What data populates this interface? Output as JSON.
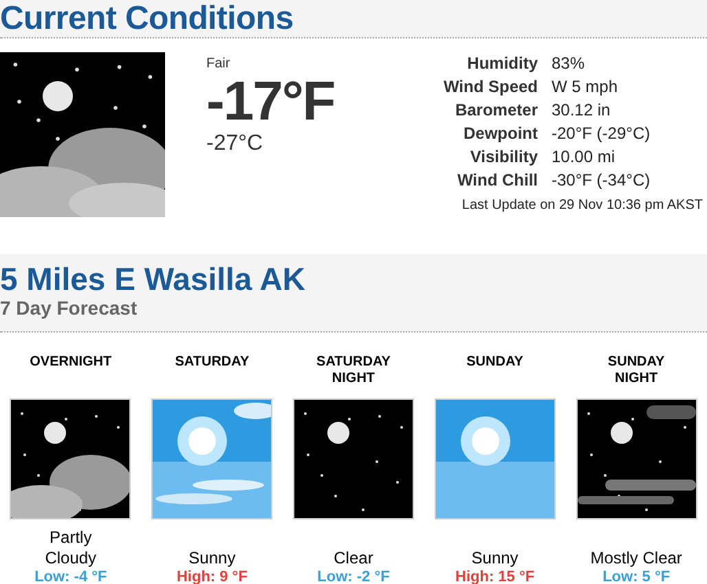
{
  "current": {
    "title": "Current Conditions",
    "condition": "Fair",
    "temp_f": "-17°F",
    "temp_c": "-27°C",
    "details": [
      {
        "label": "Humidity",
        "value": "83%"
      },
      {
        "label": "Wind Speed",
        "value": "W 5 mph"
      },
      {
        "label": "Barometer",
        "value": "30.12 in"
      },
      {
        "label": "Dewpoint",
        "value": "-20°F (-29°C)"
      },
      {
        "label": "Visibility",
        "value": "10.00 mi"
      },
      {
        "label": "Wind Chill",
        "value": "-30°F (-34°C)"
      }
    ],
    "last_update": "Last Update on 29 Nov 10:36 pm AKST"
  },
  "forecast": {
    "location": "5 Miles E Wasilla AK",
    "subtitle": "7 Day Forecast",
    "periods": [
      {
        "name": "OVERNIGHT",
        "condition": "Partly Cloudy",
        "temp": "Low: -4 °F",
        "kind": "low"
      },
      {
        "name": "SATURDAY",
        "condition": "Sunny",
        "temp": "High: 9 °F",
        "kind": "high"
      },
      {
        "name": "SATURDAY NIGHT",
        "condition": "Clear",
        "temp": "Low: -2 °F",
        "kind": "low"
      },
      {
        "name": "SUNDAY",
        "condition": "Sunny",
        "temp": "High: 15 °F",
        "kind": "high"
      },
      {
        "name": "SUNDAY NIGHT",
        "condition": "Mostly Clear",
        "temp": "Low: 5 °F",
        "kind": "low"
      }
    ]
  }
}
